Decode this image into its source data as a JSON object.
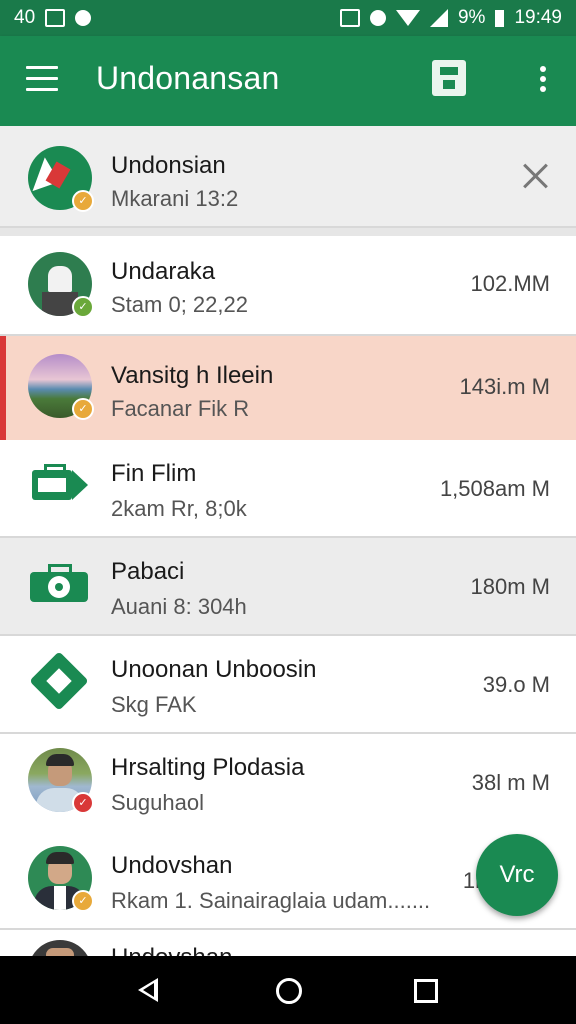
{
  "status_bar": {
    "left_text": "40",
    "battery": "9%",
    "time": "19:49"
  },
  "toolbar": {
    "title": "Undonansan",
    "icons": [
      "menu-icon",
      "save-icon",
      "overflow-menu-icon"
    ]
  },
  "pinned": {
    "title": "Undonsian",
    "subtitle": "Mkarani 13:2"
  },
  "rows": [
    {
      "title": "Undaraka",
      "subtitle": "Stam 0; 22,22",
      "size": "102.MM",
      "avatar": "lock-avatar",
      "badge_color": "#6aa83a"
    },
    {
      "title": "Vansitg h Ileein",
      "subtitle": "Facanar Fik R",
      "size": "143i.m M",
      "avatar": "landscape-photo",
      "badge_color": "#e8a93a"
    },
    {
      "title": "Fin Flim",
      "subtitle": "2kam Rr, 8;0k",
      "size": "1,508am M",
      "avatar": "briefcase-icon"
    },
    {
      "title": "Pabaci",
      "subtitle": "Auani 8: 304h",
      "size": "180m M",
      "avatar": "briefcase-eye-icon"
    },
    {
      "title": "Unoonan Unboosin",
      "subtitle": "Skg FAK",
      "size": "39.o M",
      "avatar": "diamond-tag-icon"
    },
    {
      "title": "Hrsalting Plodasia",
      "subtitle": "Suguhaol",
      "size": "38l m M",
      "avatar": "person-photo",
      "badge_color": "#d93838"
    },
    {
      "title": "Undovshan",
      "subtitle": "Rkam 1. Sainairaglaia udam.......",
      "size": "1l",
      "avatar": "person-photo-2",
      "badge_color": "#e8a93a"
    },
    {
      "title": "Undovshan",
      "subtitle": "",
      "size": "",
      "avatar": "person-photo-3"
    }
  ],
  "fab": {
    "label": "Vrc"
  },
  "colors": {
    "primary": "#1a8a52",
    "status_bar": "#1a7a4a",
    "highlight": "#f8d6c8",
    "highlight_bar": "#d93838"
  }
}
